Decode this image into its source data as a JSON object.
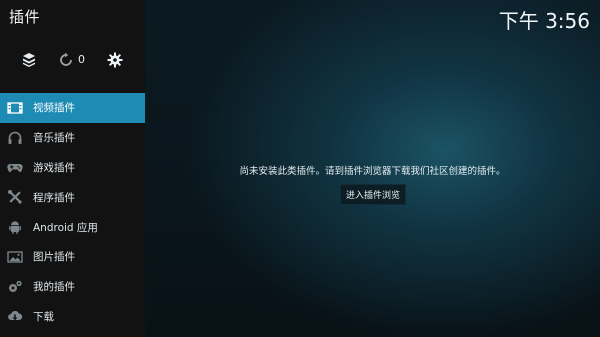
{
  "header": {
    "title": "插件",
    "clock": "下午 3:56"
  },
  "toolbar": {
    "update_count": "0"
  },
  "menu": [
    {
      "label": "视频插件",
      "icon": "film-icon"
    },
    {
      "label": "音乐插件",
      "icon": "headphones-icon"
    },
    {
      "label": "游戏插件",
      "icon": "gamepad-icon"
    },
    {
      "label": "程序插件",
      "icon": "tools-icon"
    },
    {
      "label": "Android 应用",
      "icon": "android-icon"
    },
    {
      "label": "图片插件",
      "icon": "picture-icon"
    },
    {
      "label": "我的插件",
      "icon": "gears-icon"
    },
    {
      "label": "下载",
      "icon": "cloud-download-icon"
    }
  ],
  "main": {
    "message": "尚未安装此类插件。请到插件浏览器下载我们社区创建的插件。",
    "browse_button": "进入插件浏览"
  },
  "colors": {
    "accent": "#1e8bb4",
    "sidebar": "#121212",
    "background": "#0b1a22"
  }
}
